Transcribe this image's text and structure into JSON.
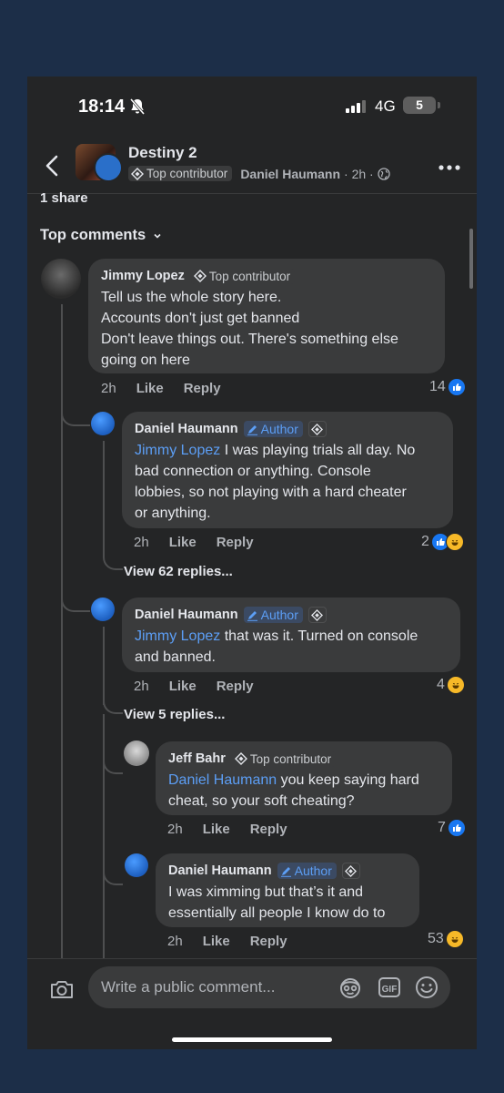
{
  "status_bar": {
    "time": "18:14",
    "network": "4G",
    "battery": "5"
  },
  "post": {
    "group_name": "Destiny 2",
    "badge": "Top contributor",
    "author": "Daniel Haumann",
    "meta": "· 2h ·",
    "shares": "1 share"
  },
  "comments_header": "Top comments",
  "comments": [
    {
      "name": "Jimmy Lopez",
      "badge": "Top contributor",
      "lines": [
        "Tell us the whole story here.",
        "Accounts don't just get banned",
        "Don't leave things out. There's something else",
        "going on here"
      ],
      "time": "2h",
      "like": "Like",
      "reply": "Like",
      "reactions": "14"
    },
    {
      "name": "Daniel Haumann",
      "badge": "Author",
      "mention": "Jimmy Lopez",
      "text_first": " I was playing trials all day. No",
      "lines": [
        "bad connection or anything. Console",
        "lobbies, so not playing with a hard cheater",
        "or anything."
      ],
      "time": "2h",
      "like": "Like",
      "reply": "Reply",
      "reactions": "2",
      "view_replies": "View 62 replies..."
    },
    {
      "name": "Daniel Haumann",
      "badge": "Author",
      "mention": "Jimmy Lopez",
      "text_first": " that was it. Turned on console",
      "lines": [
        "and banned."
      ],
      "time": "2h",
      "like": "Like",
      "reply": "Reply",
      "reactions": "4",
      "view_replies": "View 5 replies..."
    },
    {
      "name": "Jeff Bahr",
      "badge": "Top contributor",
      "mention": "Daniel Haumann",
      "text_first": " you keep saying hard",
      "lines": [
        "cheat, so your soft cheating?"
      ],
      "time": "2h",
      "like": "Like",
      "reply": "Reply",
      "reactions": "7"
    },
    {
      "name": "Daniel Haumann",
      "badge": "Author",
      "lines": [
        "I was ximming but that’s it and",
        "essentially all people I know do to"
      ],
      "time": "2h",
      "like": "Like",
      "reply": "Reply",
      "reactions": "53"
    }
  ],
  "composer": {
    "placeholder": "Write a public comment...",
    "gif": "GIF"
  },
  "icons": {
    "back": "chevron-left-icon",
    "more": "more-icon",
    "bell": "bell-slash-icon",
    "camera": "camera-icon",
    "emoji": "emoji-icon",
    "avatar_sticker": "avatar-sticker-icon"
  },
  "colors": {
    "background": "#242526",
    "bubble": "#3a3b3c",
    "accent": "#5c9ef5",
    "like": "#1877f2",
    "haha": "#f7b928"
  }
}
